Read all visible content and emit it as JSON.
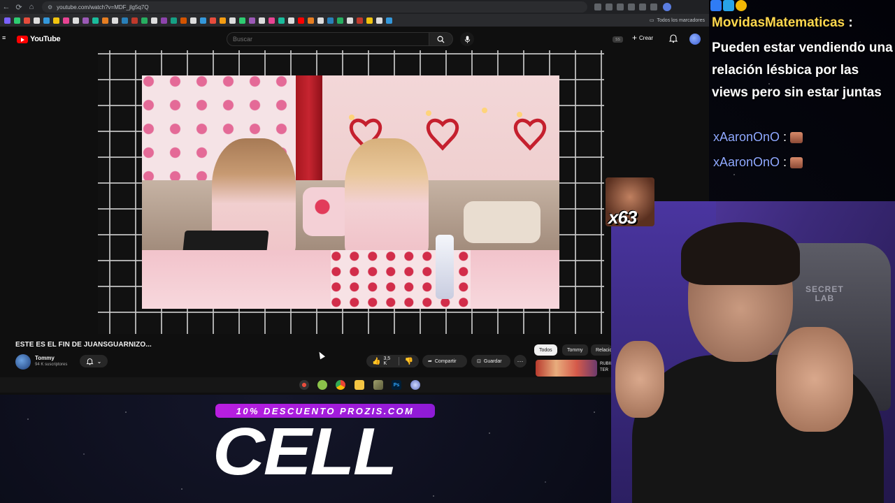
{
  "browser": {
    "url": "youtube.com/watch?v=MDF_jlg5q7Q",
    "bookmarks_folder": "Todos los marcadores"
  },
  "youtube": {
    "logo_text": "YouTube",
    "search_placeholder": "Buscar",
    "quality_badge": "SS",
    "create_label": "Crear"
  },
  "video": {
    "title": "ESTE ES EL FIN DE JUANSGUARNIZO...",
    "channel": "Tommy",
    "subscribers": "94 K suscriptores",
    "likes": "3,5 K",
    "share_label": "Compartir",
    "save_label": "Guardar",
    "more_label": "···"
  },
  "chips": [
    "Todos",
    "Tommy",
    "Relacionados"
  ],
  "recommendation": {
    "text": "RUBIUS TER"
  },
  "chat": {
    "user": "MovidasMatematicas",
    "colon": " :",
    "message": "Pueden estar vendiendo una relación lésbica por las views pero sin estar juntas",
    "lines": [
      {
        "user": "xAaronOnO",
        "sep": " :"
      },
      {
        "user": "xAaronOnO",
        "sep": " :"
      }
    ]
  },
  "overlay": {
    "emote_multiplier": "x63",
    "webcam_chair_brand_1": "SECRET",
    "webcam_chair_brand_2": "LAB",
    "promo": "10% DESCUENTO PROZIS.COM",
    "brand": "CELL"
  },
  "colors": {
    "youtube_red": "#ff0000",
    "chat_username": "#ffd84d",
    "chat_username_2": "#8fa8ff",
    "promo_purple": "#b91ee0"
  }
}
